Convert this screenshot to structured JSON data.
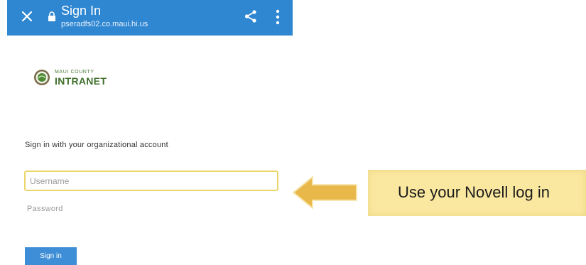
{
  "browser": {
    "title": "Sign In",
    "url": "pseradfs02.co.maui.hi.us"
  },
  "logo": {
    "small_text": "MAUI COUNTY",
    "big_text": "INTRANET"
  },
  "form": {
    "heading": "Sign in with your organizational account",
    "username_placeholder": "Username",
    "password_placeholder": "Password",
    "submit_label": "Sign in"
  },
  "annotation": {
    "callout_text": "Use your Novell log in"
  },
  "colors": {
    "topbar": "#2f86d1",
    "button": "#3d8ed6",
    "field_highlight": "#ecd66a",
    "callout": "#fbe8a0",
    "arrow": "#e9b84a"
  }
}
